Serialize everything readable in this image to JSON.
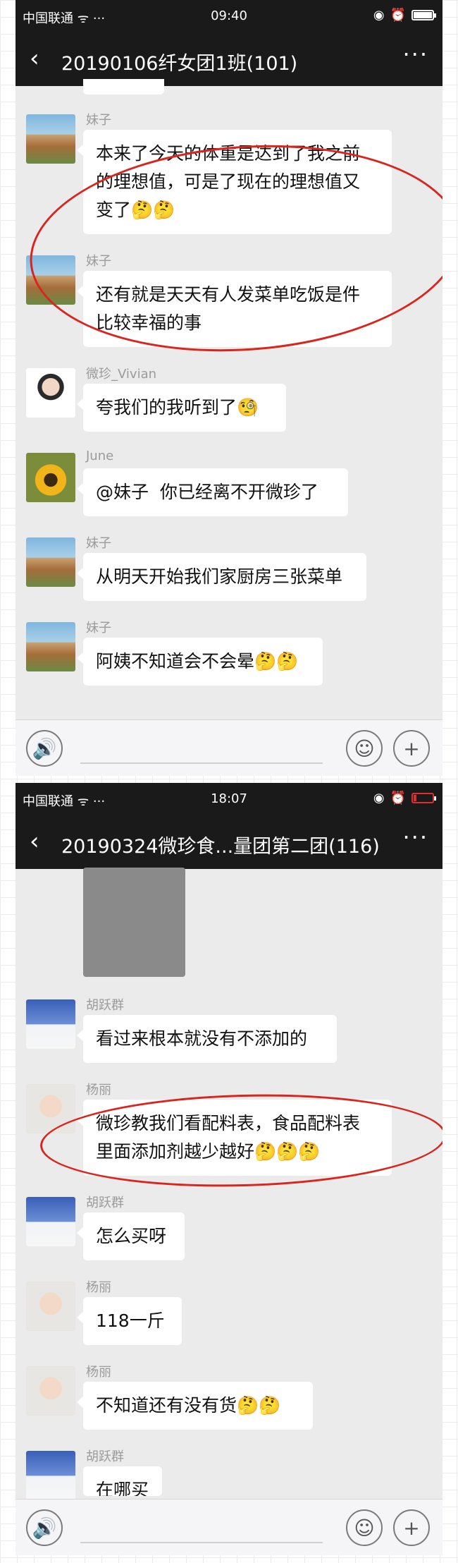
{
  "screen1": {
    "status": {
      "carrier": "中国联通 ᯤ ···",
      "time": "09:40"
    },
    "nav": {
      "back": "‹",
      "title": "20190106纤女团1班(101)",
      "more": "···"
    },
    "messages": [
      {
        "sender": "妹子",
        "text": "本来了今天的体重是达到了我之前\n的理想值，可是了现在的理想值又\n变了🤔🤔"
      },
      {
        "sender": "妹子",
        "text": "还有就是天天有人发菜单吃饭是件\n比较幸福的事"
      },
      {
        "sender": "微珍_Vivian",
        "text": "夸我们的我听到了🧐"
      },
      {
        "sender": "June",
        "text": "@妹子  你已经离不开微珍了"
      },
      {
        "sender": "妹子",
        "text": "从明天开始我们家厨房三张菜单"
      },
      {
        "sender": "妹子",
        "text": "阿姨不知道会不会晕🤔🤔"
      }
    ]
  },
  "screen2": {
    "status": {
      "carrier": "中国联通 ᯤ ···",
      "time": "18:07"
    },
    "nav": {
      "back": "‹",
      "title": "20190324微珍食...量团第二团(116)",
      "more": "···"
    },
    "messages": [
      {
        "sender": "胡跃群",
        "text": "看过来根本就没有不添加的"
      },
      {
        "sender": "杨丽",
        "text": "微珍教我们看配料表，食品配料表\n里面添加剂越少越好🤔🤔🤔"
      },
      {
        "sender": "胡跃群",
        "text": "怎么买呀"
      },
      {
        "sender": "杨丽",
        "text": "118一斤"
      },
      {
        "sender": "杨丽",
        "text": "不知道还有没有货🤔🤔"
      },
      {
        "sender": "胡跃群",
        "text": "在哪买"
      }
    ]
  },
  "inputbar": {
    "voice": "🔊",
    "emoji": "☺",
    "plus": "+"
  },
  "colors": {
    "annotation": "#d9251d",
    "navbar": "#1a1a1a",
    "chat_bg": "#ebebeb"
  }
}
